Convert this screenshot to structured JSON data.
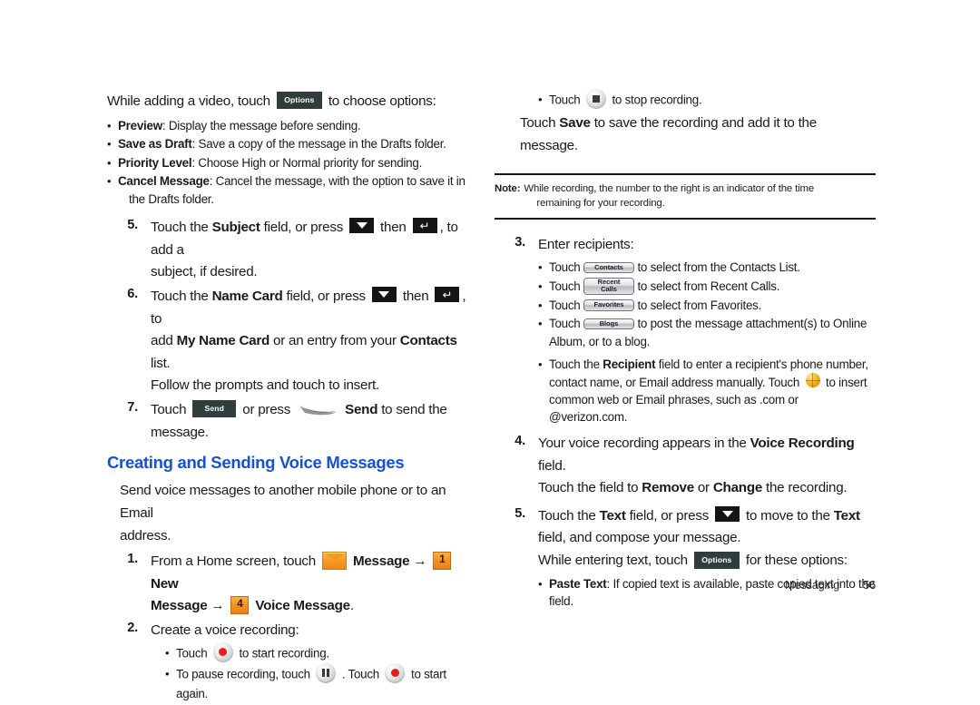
{
  "document": {
    "footer": {
      "section": "Messaging",
      "page_number": "56"
    }
  },
  "left_column": {
    "intro": {
      "before": "While adding a video, touch",
      "button_label": "Options",
      "after": "to choose options:"
    },
    "option_bullets": [
      {
        "term": "Preview",
        "desc": ": Display the message before sending."
      },
      {
        "term": "Save as Draft",
        "desc": ": Save a copy of the message in the Drafts folder."
      },
      {
        "term": "Priority Level",
        "desc": ": Choose High or Normal priority for sending."
      },
      {
        "term": "Cancel Message",
        "desc": ": Cancel the message, with the option to save it in",
        "desc2": "the Drafts folder."
      }
    ],
    "steps": [
      {
        "number": "5.",
        "line1_a": "Touch the ",
        "line1_b": "Subject",
        "line1_c": " field, or press",
        "line1_then": "then",
        "line1_d": ", to add a",
        "line2": "subject, if desired."
      },
      {
        "number": "6.",
        "line1_a": "Touch the ",
        "line1_b": "Name Card",
        "line1_c": " field, or press",
        "line1_then": "then",
        "line1_d": ", to",
        "line2_a": "add ",
        "line2_b": "My Name Card",
        "line2_c": " or an entry from your ",
        "line2_d": "Contacts",
        "line2_e": " list.",
        "line3": "Follow the prompts and touch to insert."
      },
      {
        "number": "7.",
        "line1_a": "Touch",
        "send_button": "Send",
        "line1_b": "or press",
        "line1_c": "Send",
        "line1_d": " to send the message."
      }
    ],
    "heading": "Creating and Sending Voice Messages",
    "voice_intro_line1": "Send voice messages to another mobile phone or to an Email",
    "voice_intro_line2": "address.",
    "voice_steps": [
      {
        "number": "1.",
        "line1_a": "From a Home screen, touch",
        "envelope_label": "Message",
        "badge1": "1",
        "line1_b": "New",
        "line2_a": "Message",
        "badge2": "4",
        "line2_b": "Voice Message",
        "line2_c": "."
      },
      {
        "number": "2.",
        "line1": "Create a voice recording:",
        "bullets": [
          {
            "a": "Touch",
            "b": "to start recording.",
            "icon": "record-button"
          },
          {
            "a": "To pause recording, touch",
            "b": ". Touch",
            "c": "to start again.",
            "icon": "pause-button"
          }
        ]
      }
    ],
    "arrow_glyph": "→"
  },
  "right_column": {
    "stop_bullet": {
      "a": "Touch",
      "b": "to stop recording."
    },
    "save_line1_a": "Touch ",
    "save_line1_b": "Save",
    "save_line1_c": " to save the recording and add it to the",
    "save_line2": "message.",
    "note": {
      "label": "Note:",
      "line1": "While recording, the number to the right is an indicator of the time",
      "line2": "remaining for your recording."
    },
    "steps": [
      {
        "number": "3.",
        "title": "Enter recipients:",
        "bullets": [
          {
            "a": "Touch",
            "button": "Contacts",
            "b": "to select from the Contacts List."
          },
          {
            "a": "Touch",
            "button_l1": "Recent",
            "button_l2": "Calls",
            "b": "to select from Recent Calls."
          },
          {
            "a": "Touch",
            "button": "Favorites",
            "b": "to select from Favorites."
          },
          {
            "a": "Touch",
            "button": "Blogs",
            "b": "to post  the message attachment(s) to Online",
            "b2": "Album, or to a blog."
          }
        ],
        "recipient_bullet": {
          "l1_a": "Touch the ",
          "l1_b": "Recipient",
          "l1_c": " field to enter a recipient's phone number,",
          "l2_a": "contact name, or Email address manually. Touch",
          "l2_b": "to insert",
          "l3": "common web or Email phrases, such as .com or @verizon.com."
        }
      },
      {
        "number": "4.",
        "line1_a": "Your voice recording appears in the ",
        "line1_b": "Voice Recording",
        "line1_c": " field.",
        "line2_a": "Touch the field to ",
        "line2_b": "Remove",
        "line2_c": " or ",
        "line2_d": "Change",
        "line2_e": " the recording."
      },
      {
        "number": "5.",
        "line1_a": "Touch the ",
        "line1_b": "Text",
        "line1_c": " field, or press",
        "line1_d": " to move to the ",
        "line1_e": "Text",
        "line2": "field, and compose your message.",
        "line3_a": "While entering text, touch",
        "options_button": "Options",
        "line3_b": "for these options:",
        "paste_bullet": {
          "term": "Paste Text",
          "desc": ": If copied text is available, paste copied text into the",
          "desc2": "field."
        }
      }
    ]
  },
  "colors": {
    "heading_blue": "#1352d8",
    "softkey_dark": "#2f3d3c",
    "badge_orange": "#f59120",
    "record_red": "#e81d1d"
  }
}
